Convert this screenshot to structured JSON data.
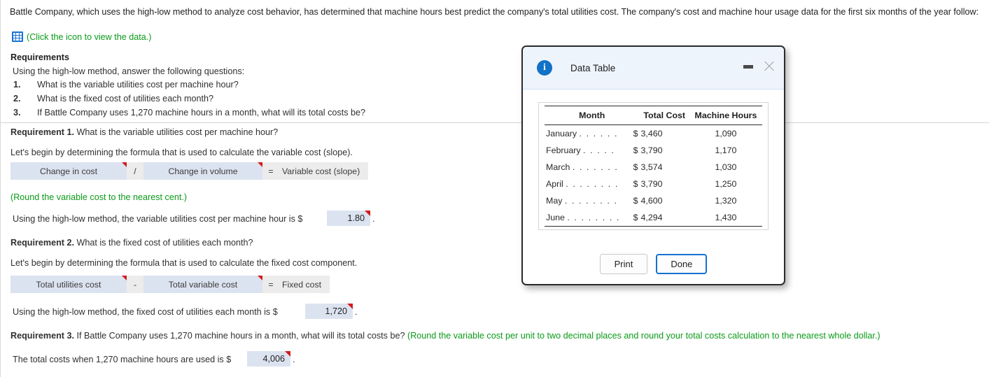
{
  "intro": {
    "paragraph": "Battle Company, which uses the high-low method to analyze cost behavior, has determined that machine hours best predict the company's total utilities cost. The company's cost and machine hour usage data for the first six months of the year follow:",
    "data_link": "(Click the icon to view the data.)",
    "data_link_icon": "spreadsheet-grid-icon"
  },
  "requirements": {
    "heading": "Requirements",
    "subheading": "Using the high-low method, answer the following questions:",
    "items": [
      {
        "num": "1.",
        "text": "What is the variable utilities cost per machine hour?"
      },
      {
        "num": "2.",
        "text": "What is the fixed cost of utilities each month?"
      },
      {
        "num": "3.",
        "text": "If Battle Company uses 1,270 machine hours in a month, what will its total costs be?"
      }
    ]
  },
  "req1": {
    "label": "Requirement 1.",
    "question": "What is the variable utilities cost per machine hour?",
    "lead_in": "Let's begin by determining the formula that is used to calculate the variable cost (slope).",
    "formula": {
      "term1": "Change in cost",
      "operator": "/",
      "term2": "Change in volume",
      "equals": "=",
      "result": "Variable cost (slope)"
    },
    "hint": "(Round the variable cost to the nearest cent.)",
    "answer_prefix": "Using the high-low method, the variable utilities cost per machine hour is $",
    "answer_value": "1.80",
    "answer_suffix": "."
  },
  "req2": {
    "label": "Requirement 2.",
    "question": "What is the fixed cost of utilities each month?",
    "lead_in": "Let's begin by determining the formula that is used to calculate the fixed cost component.",
    "formula": {
      "term1": "Total utilities cost",
      "operator": "-",
      "term2": "Total variable cost",
      "equals": "=",
      "result": "Fixed cost"
    },
    "answer_prefix": "Using the high-low method, the fixed cost of utilities each month is $",
    "answer_value": "1,720",
    "answer_suffix": "."
  },
  "req3": {
    "label": "Requirement 3.",
    "question": "If Battle Company uses 1,270 machine hours in a month, what will its total costs be?",
    "hint": "(Round the variable cost per unit to two decimal places and round your total costs calculation to the nearest whole dollar.)",
    "answer_prefix": "The total costs when 1,270 machine hours are used is $",
    "answer_value": "4,006",
    "answer_suffix": "."
  },
  "modal": {
    "title": "Data Table",
    "icon": "info-icon",
    "minimize_label": "minimize-icon",
    "close_label": "close-icon",
    "table": {
      "columns": [
        "Month",
        "Total Cost",
        "Machine Hours"
      ],
      "rows": [
        {
          "month": "January",
          "dots": ". . . . . .",
          "currency": "$",
          "total_cost": "3,460",
          "machine_hours": "1,090"
        },
        {
          "month": "February",
          "dots": ". . . . .",
          "currency": "$",
          "total_cost": "3,790",
          "machine_hours": "1,170"
        },
        {
          "month": "March",
          "dots": ". . . . . . .",
          "currency": "$",
          "total_cost": "3,574",
          "machine_hours": "1,030"
        },
        {
          "month": "April",
          "dots": ". . . . . . . .",
          "currency": "$",
          "total_cost": "3,790",
          "machine_hours": "1,250"
        },
        {
          "month": "May",
          "dots": ". . . . . . . .",
          "currency": "$",
          "total_cost": "4,600",
          "machine_hours": "1,320"
        },
        {
          "month": "June",
          "dots": ". . . . . . . .",
          "currency": "$",
          "total_cost": "4,294",
          "machine_hours": "1,430"
        }
      ]
    },
    "buttons": {
      "print": "Print",
      "done": "Done"
    }
  },
  "colors": {
    "hint_green": "#0a9b18",
    "field_blue": "#dce3f0",
    "flag_red": "#d21b1b",
    "focus_blue": "#1471d0",
    "icon_blue": "#1a73d4"
  }
}
